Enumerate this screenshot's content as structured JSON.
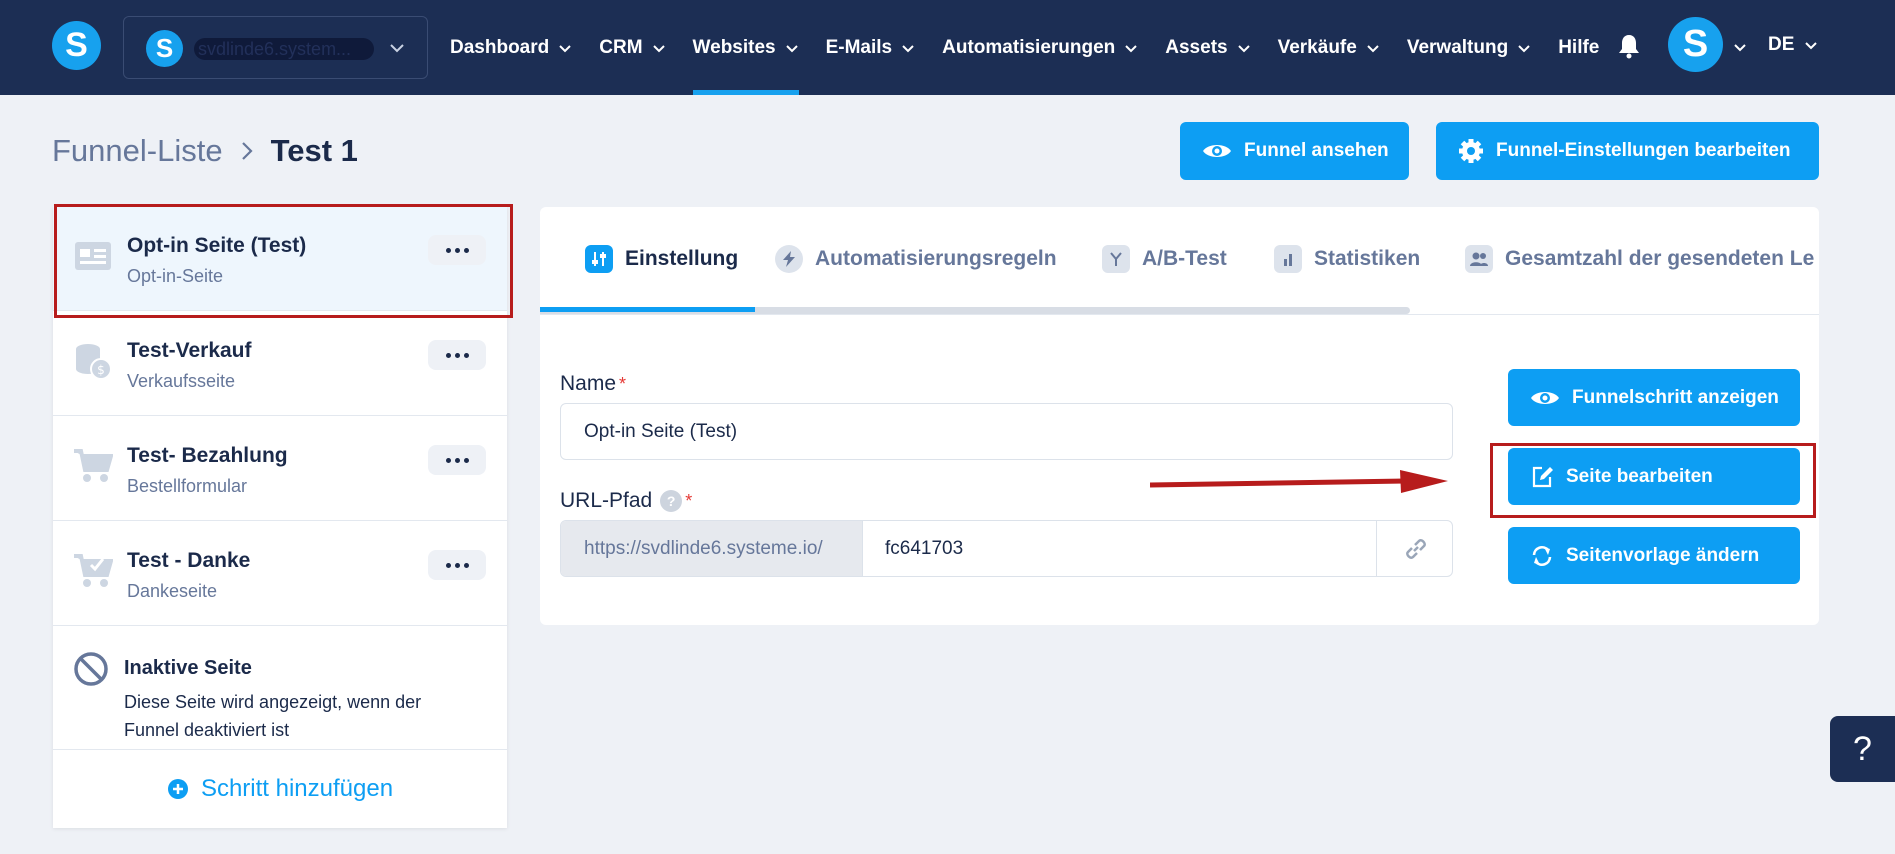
{
  "app": {
    "logo_letter": "S",
    "workspace": {
      "logo_letter": "S",
      "name": "svdlinde6.system..."
    }
  },
  "nav": {
    "items": [
      {
        "label": "Dashboard",
        "active": false,
        "has_dropdown": true
      },
      {
        "label": "CRM",
        "active": false,
        "has_dropdown": true
      },
      {
        "label": "Websites",
        "active": true,
        "has_dropdown": true
      },
      {
        "label": "E-Mails",
        "active": false,
        "has_dropdown": true
      },
      {
        "label": "Automatisierungen",
        "active": false,
        "has_dropdown": true
      },
      {
        "label": "Assets",
        "active": false,
        "has_dropdown": true
      },
      {
        "label": "Verkäufe",
        "active": false,
        "has_dropdown": true
      },
      {
        "label": "Verwaltung",
        "active": false,
        "has_dropdown": true
      },
      {
        "label": "Hilfe",
        "active": false,
        "has_dropdown": false
      }
    ],
    "bell_icon": "bell-icon",
    "avatar_letter": "S",
    "language": "DE"
  },
  "breadcrumb": {
    "parent": "Funnel-Liste",
    "current": "Test 1"
  },
  "header_buttons": {
    "view_funnel": "Funnel ansehen",
    "funnel_settings": "Funnel-Einstellungen bearbeiten"
  },
  "steps": [
    {
      "title": "Opt-in Seite (Test)",
      "subtitle": "Opt-in-Seite",
      "icon": "optin-page-icon",
      "selected": true
    },
    {
      "title": "Test-Verkauf",
      "subtitle": "Verkaufsseite",
      "icon": "coins-icon",
      "selected": false
    },
    {
      "title": "Test- Bezahlung",
      "subtitle": "Bestellformular",
      "icon": "cart-icon",
      "selected": false
    },
    {
      "title": "Test - Danke",
      "subtitle": "Dankeseite",
      "icon": "cart-check-icon",
      "selected": false
    }
  ],
  "inactive_page": {
    "title": "Inaktive Seite",
    "text": "Diese Seite wird angezeigt, wenn der Funnel deaktiviert ist"
  },
  "add_step": "Schritt hinzufügen",
  "tabs": [
    {
      "label": "Einstellung",
      "active": true
    },
    {
      "label": "Automatisierungsregeln",
      "active": false
    },
    {
      "label": "A/B-Test",
      "active": false
    },
    {
      "label": "Statistiken",
      "active": false
    },
    {
      "label": "Gesamtzahl der gesendeten Le",
      "active": false
    }
  ],
  "form": {
    "name_label": "Name",
    "name_value": "Opt-in Seite (Test)",
    "url_label": "URL-Pfad",
    "url_prefix": "https://svdlinde6.systeme.io/",
    "url_slug": "fc641703",
    "required_mark": "*",
    "help_mark": "?"
  },
  "side_buttons": {
    "show_step": "Funnelschritt anzeigen",
    "edit_page": "Seite bearbeiten",
    "change_template": "Seitenvorlage ändern"
  },
  "help_widget": "?",
  "colors": {
    "topbar": "#1c2e54",
    "accent": "#0d9ef3",
    "annotation": "#b71c1c"
  }
}
